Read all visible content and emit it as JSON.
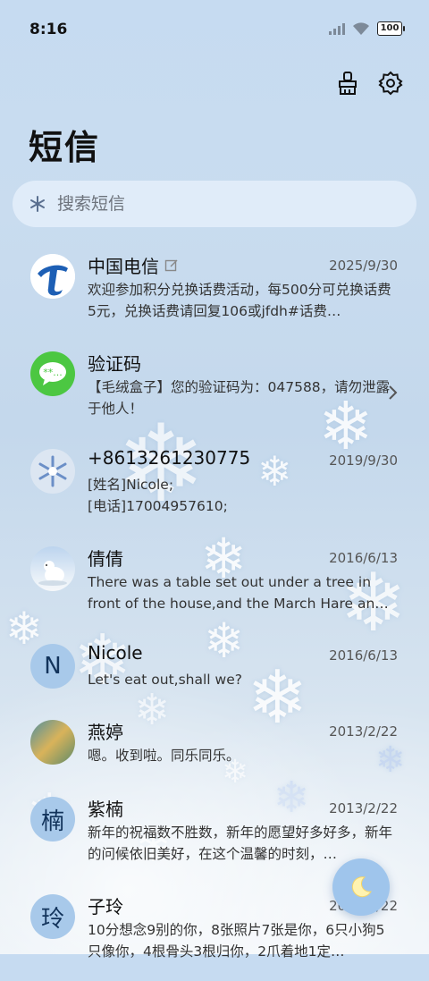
{
  "status_bar": {
    "time": "8:16",
    "battery": "100"
  },
  "header": {
    "title": "短信",
    "clean_icon": "broom-icon",
    "settings_icon": "gear-icon"
  },
  "search": {
    "placeholder": "搜索短信"
  },
  "conversations": [
    {
      "name": "中国电信",
      "date": "2025/9/30",
      "preview": "欢迎参加积分兑换话费活动，每500分可兑换话费5元，兑换话费请回复106或jfdh#话费…",
      "avatar": "china-telecom-logo",
      "has_edit_icon": true
    },
    {
      "name": "验证码",
      "date": "",
      "preview": "【毛绒盒子】您的验证码为：047588，请勿泄露于他人！",
      "avatar": "sms-bubble-icon"
    },
    {
      "name": "+8613261230775",
      "date": "2019/9/30",
      "preview_lines": [
        "[姓名]Nicole;",
        "[电话]17004957610;"
      ],
      "avatar": "snowflake-photo"
    },
    {
      "name": "倩倩",
      "date": "2016/6/13",
      "preview": "There was a table set out under a tree in front of the house,and the March Hare an…",
      "avatar": "polar-bear-photo"
    },
    {
      "name": "Nicole",
      "date": "2016/6/13",
      "preview": "Let's eat out,shall we?",
      "avatar_letter": "N"
    },
    {
      "name": "燕婷",
      "date": "2013/2/22",
      "preview": "嗯。收到啦。同乐同乐。",
      "avatar": "landscape-photo"
    },
    {
      "name": "紫楠",
      "date": "2013/2/22",
      "preview": "新年的祝福数不胜数，新年的愿望好多好多，新年的问候依旧美好，在这个温馨的时刻，…",
      "avatar_letter": "楠"
    },
    {
      "name": "子玲",
      "date": "2013/2/22",
      "preview": "10分想念9别的你，8张照片7张是你，6只小狗5只像你，4根骨头3根归你，2爪着地1定…",
      "avatar_letter": "玲"
    }
  ],
  "fab": {
    "icon": "moon-icon"
  }
}
